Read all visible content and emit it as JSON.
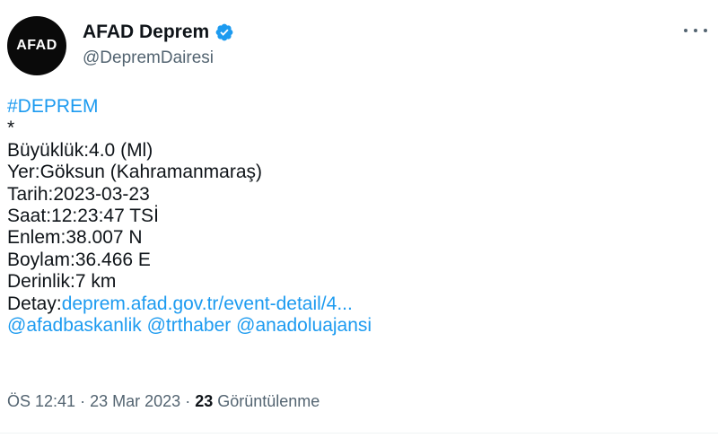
{
  "author": {
    "avatar_text": "AFAD",
    "display_name": "AFAD Deprem",
    "handle": "@DepremDairesi",
    "verified_icon": "verified-badge-icon"
  },
  "menu": {
    "icon": "more-options-icon"
  },
  "tweet": {
    "hashtag": "#DEPREM",
    "asterisk": "*",
    "buyukluk": "Büyüklük:4.0 (Ml)",
    "yer": "Yer:Göksun (Kahramanmaraş)",
    "tarih": "Tarih:2023-03-23",
    "saat": "Saat:12:23:47 TSİ",
    "enlem": "Enlem:38.007 N",
    "boylam": "Boylam:36.466 E",
    "derinlik": "Derinlik:7 km",
    "detay_label": "Detay:",
    "detay_link": "deprem.afad.gov.tr/event-detail/4...",
    "mentions": [
      "@afadbaskanlik",
      "@trthaber",
      "@anadoluajansi"
    ]
  },
  "meta": {
    "time": "ÖS 12:41",
    "separator": "·",
    "date": "23 Mar 2023",
    "views_count": "23",
    "views_label": "Görüntülenme"
  },
  "colors": {
    "link": "#1d9bf0",
    "verified": "#1d9bf0",
    "secondary_text": "#536471",
    "primary_text": "#0f1419"
  }
}
